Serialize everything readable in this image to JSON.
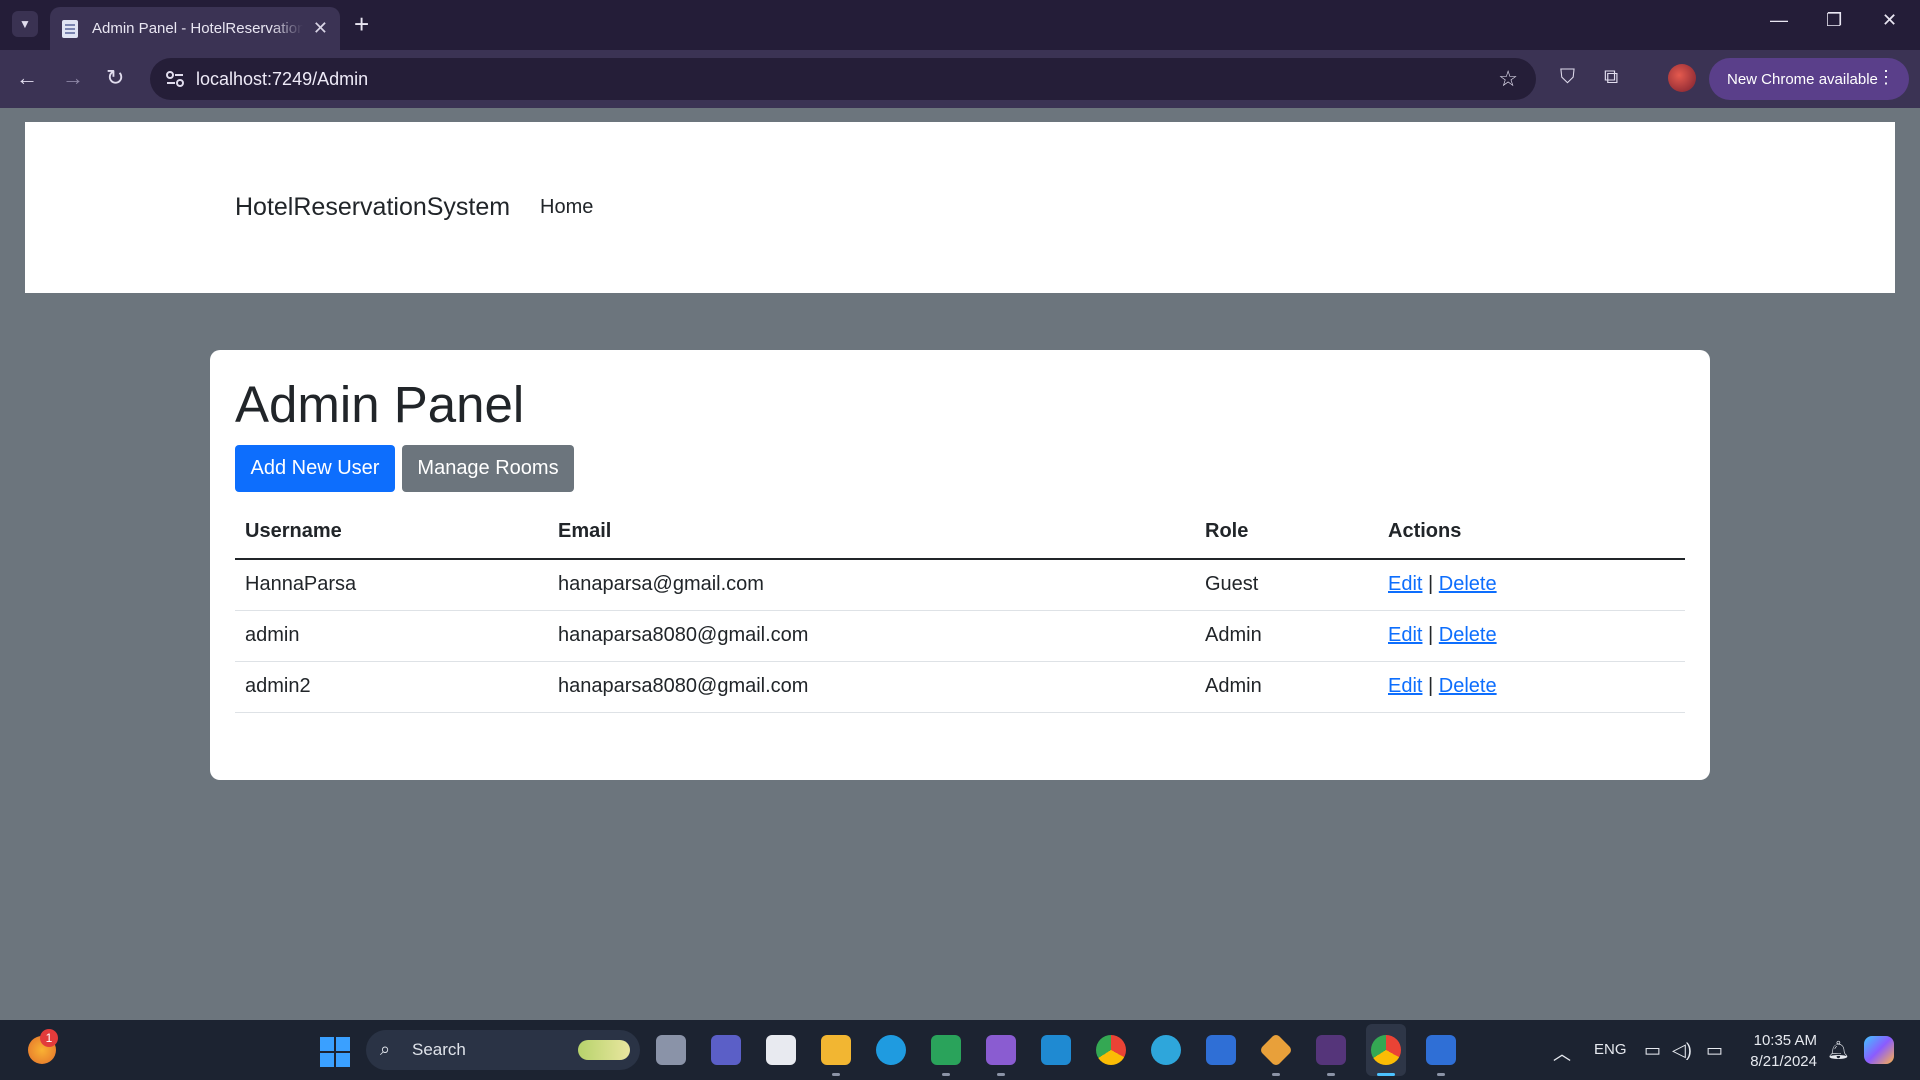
{
  "browser": {
    "tab": {
      "title": "Admin Panel - HotelReservationSystem",
      "close": "✕"
    },
    "new_tab": "+",
    "window_controls": {
      "minimize": "—",
      "restore": "❐",
      "close": "✕"
    },
    "address": "localhost:7249/Admin",
    "update_button": "New Chrome available"
  },
  "navbar": {
    "brand": "HotelReservationSystem",
    "links": [
      {
        "label": "Home"
      }
    ]
  },
  "main": {
    "title": "Admin Panel",
    "buttons": {
      "add_user": "Add New User",
      "manage_rooms": "Manage Rooms"
    },
    "table": {
      "headers": [
        "Username",
        "Email",
        "Role",
        "Actions"
      ],
      "rows": [
        {
          "username": "HannaParsa",
          "email": "hanaparsa@gmail.com",
          "role": "Guest",
          "edit": "Edit",
          "separator": "|",
          "delete": "Delete"
        },
        {
          "username": "admin",
          "email": "hanaparsa8080@gmail.com",
          "role": "Admin",
          "edit": "Edit",
          "separator": "|",
          "delete": "Delete"
        },
        {
          "username": "admin2",
          "email": "hanaparsa8080@gmail.com",
          "role": "Admin",
          "edit": "Edit",
          "separator": "|",
          "delete": "Delete"
        }
      ]
    }
  },
  "taskbar": {
    "weather_badge": "1",
    "search_placeholder": "Search",
    "language": "ENG",
    "time": "10:35 AM",
    "date": "8/21/2024",
    "apps": [
      "task-view",
      "teams",
      "store",
      "file-explorer",
      "edge",
      "excel",
      "visual-studio",
      "vscode",
      "chrome",
      "telegram",
      "vpn",
      "git",
      "terminal",
      "chrome-active",
      "windows-security"
    ]
  },
  "colors": {
    "page_bg": "#6c757d",
    "primary": "#0d6efd",
    "secondary": "#6c757d",
    "chrome_frame": "#241d38",
    "chrome_toolbar": "#3b3354"
  }
}
